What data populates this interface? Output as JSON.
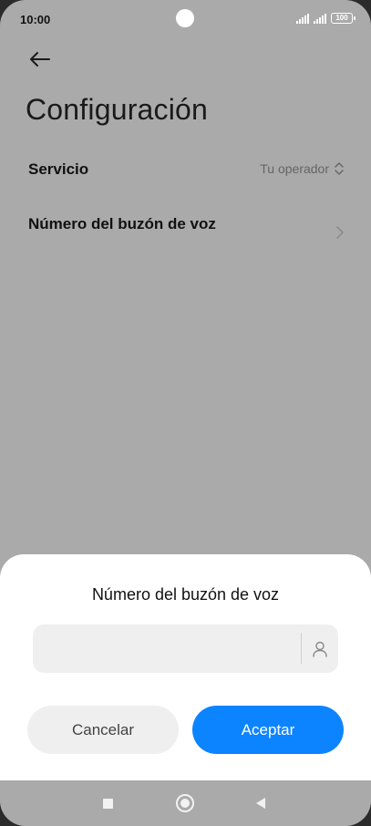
{
  "status_bar": {
    "time": "10:00",
    "battery": "100"
  },
  "header": {
    "back_icon": "arrow-left-icon",
    "title": "Configuración"
  },
  "settings": {
    "service": {
      "label": "Servicio",
      "value": "Tu operador",
      "icon": "chevron-up-down-icon"
    },
    "voicemail_number": {
      "label": "Número del buzón de voz",
      "icon": "chevron-right-icon"
    }
  },
  "dialog": {
    "title": "Número del buzón de voz",
    "input": {
      "value": "",
      "placeholder": ""
    },
    "contact_icon": "person-icon",
    "cancel_label": "Cancelar",
    "accept_label": "Aceptar"
  },
  "colors": {
    "accent": "#0d84ff",
    "dim_background": "#aaaaaa",
    "dialog_background": "#ffffff"
  },
  "nav_bar": {
    "recents_icon": "square-icon",
    "home_icon": "circle-icon",
    "back_icon": "triangle-back-icon"
  }
}
